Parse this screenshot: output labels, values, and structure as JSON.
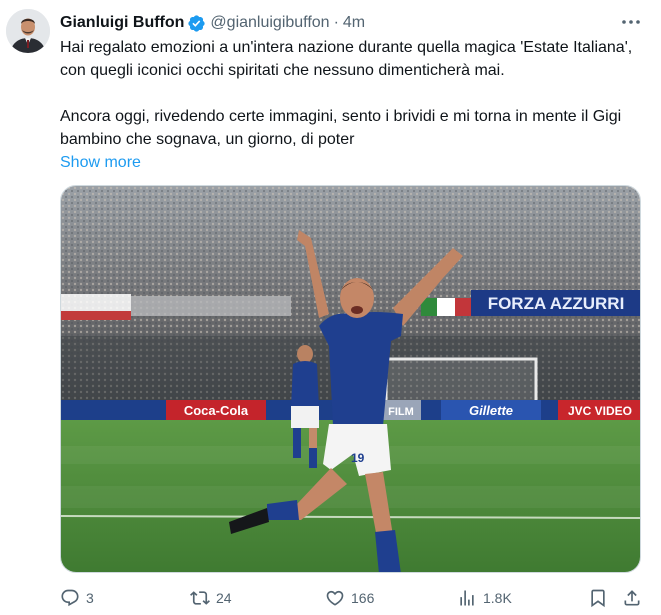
{
  "author": {
    "name": "Gianluigi Buffon",
    "handle": "@gianluigibuffon",
    "separator": "·",
    "time": "4m",
    "avatar_icon": "avatar"
  },
  "tweet": {
    "paragraph1": "Hai regalato emozioni a un'intera nazione durante quella magica 'Estate Italiana', con quegli iconici occhi spiritati che nessuno dimenticherà mai.",
    "paragraph2": "Ancora oggi, rivedendo certe immagini, sento i brividi e mi torna in mente il Gigi bambino che sognava, un giorno, di poter",
    "show_more": "Show more"
  },
  "media": {
    "banner_left": "FORZA AZZURRI",
    "banner_coca": "Coca-Cola",
    "banner_film": "FILM",
    "banner_gillette": "Gillette",
    "banner_jvc": "JVC VIDEO",
    "shirt_number": "19"
  },
  "actions": {
    "replies": "3",
    "reposts": "24",
    "likes": "166",
    "views": "1.8K"
  },
  "colors": {
    "accent": "#1d9bf0",
    "verified": "#1d9bf0",
    "muted": "#536471",
    "italy_blue": "#1f3f8f",
    "pitch_green": "#4f8a3c"
  }
}
